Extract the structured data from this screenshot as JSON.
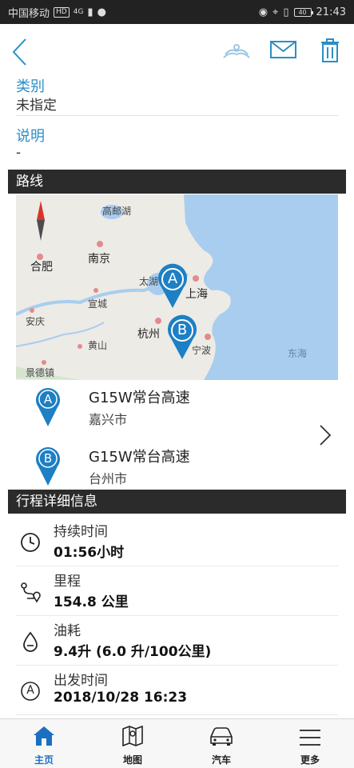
{
  "status_bar": {
    "carrier": "中国移动",
    "hd": "HD",
    "net": "4G",
    "battery": "40",
    "time": "21:43"
  },
  "fields": {
    "category_label": "类别",
    "category_value": "未指定",
    "description_label": "说明",
    "description_value": "-"
  },
  "route": {
    "section_title": "路线",
    "map_labels": {
      "gaoyou": "高邮湖",
      "hefei": "合肥",
      "nanjing": "南京",
      "taihu": "太湖",
      "shanghai": "上海",
      "xuancheng": "宣城",
      "anqing": "安庆",
      "hangzhou": "杭州",
      "huangshan": "黄山",
      "ningbo": "宁波",
      "jingdezhen": "景德镇",
      "donghai": "东海"
    },
    "marker_a": "A",
    "marker_b": "B",
    "start": {
      "pin": "A",
      "road": "G15W常台高速",
      "city": "嘉兴市"
    },
    "end": {
      "pin": "B",
      "road": "G15W常台高速",
      "city": "台州市"
    }
  },
  "trip": {
    "section_title": "行程详细信息",
    "duration_label": "持续时间",
    "duration_value": "01:56小时",
    "distance_label": "里程",
    "distance_value": "154.8 公里",
    "fuel_label": "油耗",
    "fuel_value": "9.4升 (6.0 升/100公里)",
    "departure_label": "出发时间",
    "departure_value": "2018/10/28 16:23",
    "departure_icon_letter": "A"
  },
  "tabs": {
    "home": "主页",
    "map": "地图",
    "car": "汽车",
    "more": "更多"
  },
  "colors": {
    "accent": "#2a8fc6",
    "pin": "#1d7fc4",
    "tab_active": "#1b6fc0"
  }
}
